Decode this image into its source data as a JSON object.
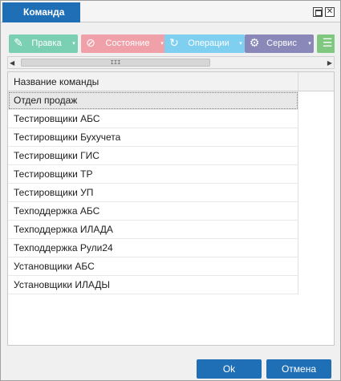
{
  "window": {
    "title": "Команда",
    "max_glyph": "",
    "close_glyph": "✕"
  },
  "toolbar": {
    "edit": {
      "label": "Правка",
      "icon": "✎",
      "arrow": "▾"
    },
    "state": {
      "label": "Состояние",
      "icon": "⊘",
      "arrow": "▾"
    },
    "ops": {
      "label": "Операции",
      "icon": "↻",
      "arrow": "▾"
    },
    "service": {
      "label": "Сервис",
      "icon": "⚙",
      "arrow": "▾"
    },
    "extra": {
      "icon": "☰"
    }
  },
  "hscroll": {
    "left_arrow": "◀",
    "right_arrow": "▶",
    "grip": "III"
  },
  "grid": {
    "column_header": "Название команды",
    "rows": [
      "Отдел продаж",
      "Тестировщики АБС",
      "Тестировщики Бухучета",
      "Тестировщики ГИС",
      "Тестировщики ТР",
      "Тестировщики УП",
      "Техподдержка АБС",
      "Техподдержка ИЛАДА",
      "Техподдержка Рули24",
      "Установщики АБС",
      "Установщики ИЛАДЫ"
    ]
  },
  "buttons": {
    "ok": "Ok",
    "cancel": "Отмена"
  }
}
